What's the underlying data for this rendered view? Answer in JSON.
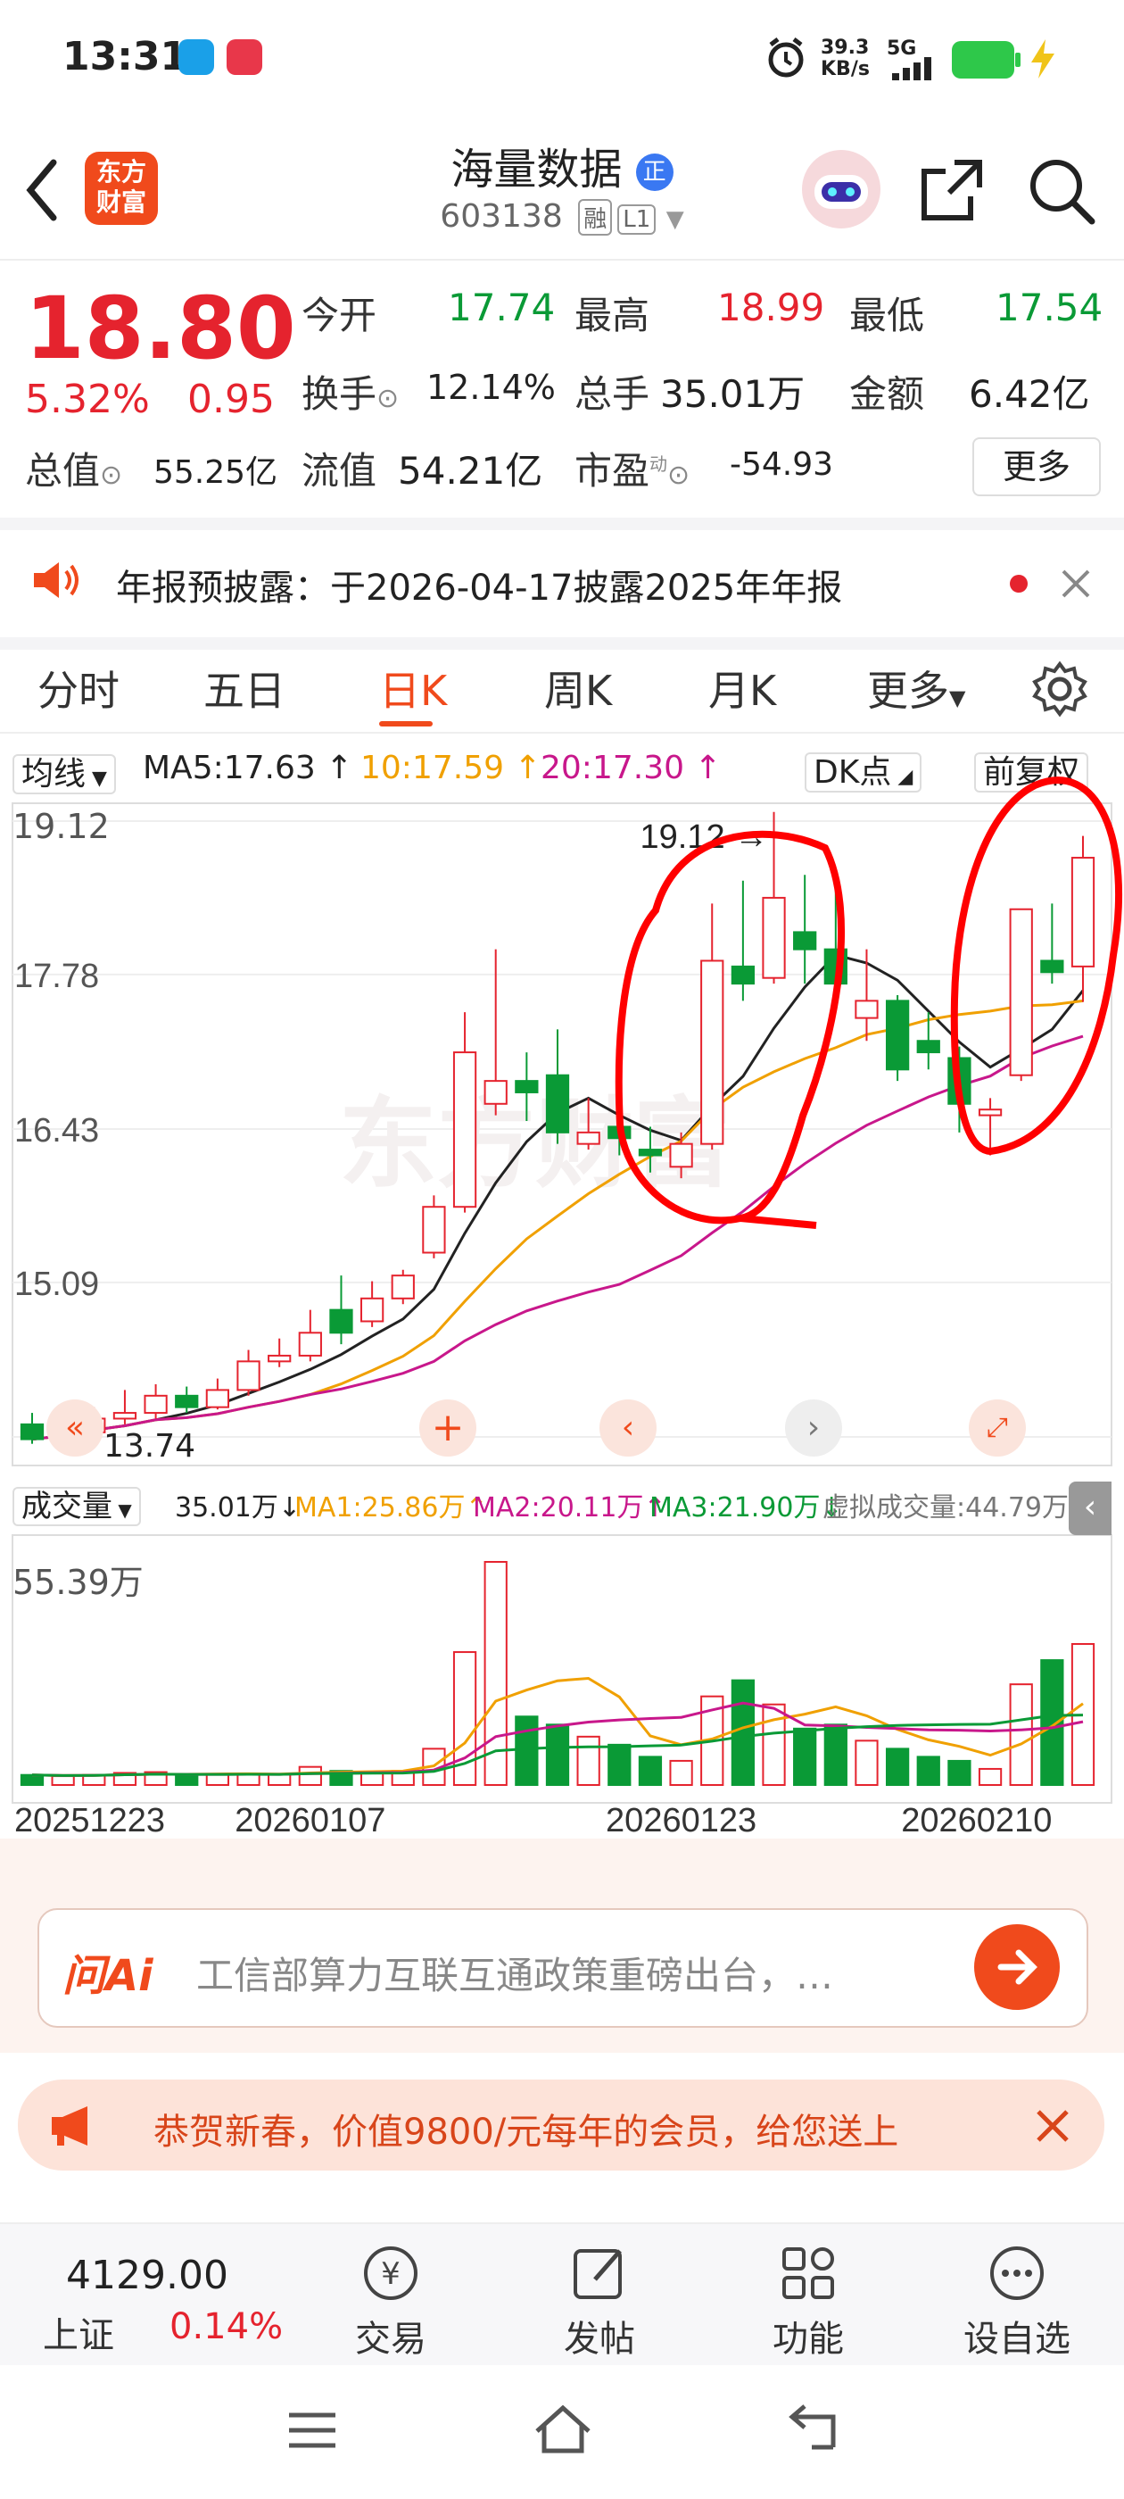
{
  "status_bar": {
    "time": "13:31",
    "speed": "39.3",
    "speed_unit": "KB/s",
    "network": "5G"
  },
  "header": {
    "logo_line1": "东方",
    "logo_line2": "财富",
    "stock_name": "海量数据",
    "badge": "正",
    "stock_code": "603138",
    "tag1": "融",
    "tag2": "L1"
  },
  "quote": {
    "price": "18.80",
    "change_pct": "5.32%",
    "change": "0.95",
    "open_label": "今开",
    "open": "17.74",
    "high_label": "最高",
    "high": "18.99",
    "low_label": "最低",
    "low": "17.54",
    "turnover_label": "换手",
    "turnover": "12.14%",
    "volume_label": "总手",
    "volume": "35.01万",
    "amount_label": "金额",
    "amount": "6.42亿",
    "mktcap_label": "总值",
    "mktcap": "55.25亿",
    "float_label": "流值",
    "float": "54.21亿",
    "pe_label": "市盈",
    "pe_sup": "动",
    "pe": "-54.93",
    "more": "更多"
  },
  "notice": {
    "text": "年报预披露：于2026-04-17披露2025年年报"
  },
  "tabs": {
    "items": [
      "分时",
      "五日",
      "日K",
      "周K",
      "月K",
      "更多"
    ],
    "active": "日K"
  },
  "chart_controls": {
    "ma_selector": "均线",
    "ma5": "MA5:17.63 ↑",
    "ma10": "10:17.59 ↑",
    "ma20": "20:17.30 ↑",
    "dk": "DK点",
    "adjust": "前复权",
    "max_label": "19.12",
    "min_label": "13.74",
    "vol_selector": "成交量",
    "vol": "35.01万↓",
    "vol_ma1": "MA1:25.86万↑",
    "vol_ma2": "MA2:20.11万↑",
    "vol_ma3": "MA3:21.90万↓",
    "virtual_vol": "虚拟成交量:44.79万",
    "vol_max": "55.39万"
  },
  "chart_data": {
    "type": "candlestick",
    "price_axis": {
      "ticks": [
        19.12,
        17.78,
        16.43,
        15.09,
        13.74
      ],
      "range": [
        13.74,
        19.12
      ]
    },
    "dates": [
      "20251223",
      "20260107",
      "20260123",
      "20260210"
    ],
    "candles": [
      {
        "o": 13.85,
        "c": 13.72,
        "h": 13.95,
        "l": 13.68,
        "v": 2.5
      },
      {
        "o": 13.72,
        "c": 13.78,
        "h": 13.85,
        "l": 13.7,
        "v": 2.2
      },
      {
        "o": 13.78,
        "c": 13.9,
        "h": 14.0,
        "l": 13.75,
        "v": 2.5
      },
      {
        "o": 13.9,
        "c": 13.95,
        "h": 14.15,
        "l": 13.85,
        "v": 3.0
      },
      {
        "o": 13.95,
        "c": 14.1,
        "h": 14.2,
        "l": 13.9,
        "v": 3.2
      },
      {
        "o": 14.1,
        "c": 14.0,
        "h": 14.18,
        "l": 13.95,
        "v": 2.4
      },
      {
        "o": 14.0,
        "c": 14.15,
        "h": 14.25,
        "l": 13.98,
        "v": 2.6
      },
      {
        "o": 14.15,
        "c": 14.4,
        "h": 14.5,
        "l": 14.1,
        "v": 2.8
      },
      {
        "o": 14.4,
        "c": 14.45,
        "h": 14.6,
        "l": 14.35,
        "v": 2.6
      },
      {
        "o": 14.45,
        "c": 14.65,
        "h": 14.85,
        "l": 14.4,
        "v": 4.5
      },
      {
        "o": 14.85,
        "c": 14.65,
        "h": 15.15,
        "l": 14.55,
        "v": 3.5
      },
      {
        "o": 14.75,
        "c": 14.95,
        "h": 15.1,
        "l": 14.7,
        "v": 3.2
      },
      {
        "o": 14.95,
        "c": 15.15,
        "h": 15.2,
        "l": 14.9,
        "v": 3.5
      },
      {
        "o": 15.35,
        "c": 15.75,
        "h": 15.85,
        "l": 15.3,
        "v": 9.0
      },
      {
        "o": 15.75,
        "c": 17.1,
        "h": 17.45,
        "l": 15.7,
        "v": 33.0
      },
      {
        "o": 16.65,
        "c": 16.85,
        "h": 18.0,
        "l": 16.55,
        "v": 55.39
      },
      {
        "o": 16.85,
        "c": 16.75,
        "h": 17.1,
        "l": 16.5,
        "v": 17.0
      },
      {
        "o": 16.9,
        "c": 16.4,
        "h": 17.3,
        "l": 16.3,
        "v": 15.0
      },
      {
        "o": 16.3,
        "c": 16.4,
        "h": 16.7,
        "l": 16.25,
        "v": 12.0
      },
      {
        "o": 16.45,
        "c": 16.35,
        "h": 16.5,
        "l": 16.2,
        "v": 10.0
      },
      {
        "o": 16.25,
        "c": 16.2,
        "h": 16.45,
        "l": 16.05,
        "v": 7.0
      },
      {
        "o": 16.1,
        "c": 16.3,
        "h": 16.4,
        "l": 16.0,
        "v": 6.0
      },
      {
        "o": 16.3,
        "c": 17.9,
        "h": 18.4,
        "l": 16.25,
        "v": 22.0
      },
      {
        "o": 17.85,
        "c": 17.7,
        "h": 18.6,
        "l": 17.55,
        "v": 26.0
      },
      {
        "o": 17.75,
        "c": 18.45,
        "h": 19.2,
        "l": 17.7,
        "v": 20.0
      },
      {
        "o": 18.15,
        "c": 18.0,
        "h": 18.65,
        "l": 17.7,
        "v": 14.0
      },
      {
        "o": 18.0,
        "c": 17.7,
        "h": 18.7,
        "l": 17.6,
        "v": 15.0
      },
      {
        "o": 17.4,
        "c": 17.55,
        "h": 18.0,
        "l": 17.2,
        "v": 11.0
      },
      {
        "o": 17.55,
        "c": 16.95,
        "h": 17.6,
        "l": 16.85,
        "v": 9.0
      },
      {
        "o": 17.2,
        "c": 17.1,
        "h": 17.45,
        "l": 16.95,
        "v": 7.0
      },
      {
        "o": 17.05,
        "c": 16.65,
        "h": 17.15,
        "l": 16.4,
        "v": 6.0
      },
      {
        "o": 16.55,
        "c": 16.6,
        "h": 16.7,
        "l": 16.2,
        "v": 4.0
      },
      {
        "o": 16.9,
        "c": 18.35,
        "h": 18.35,
        "l": 16.85,
        "v": 25.0
      },
      {
        "o": 17.9,
        "c": 17.8,
        "h": 18.4,
        "l": 17.7,
        "v": 31.0
      },
      {
        "o": 17.85,
        "c": 18.8,
        "h": 18.99,
        "l": 17.54,
        "v": 35.01
      }
    ]
  },
  "ai": {
    "logo": "问Ai",
    "query": "工信部算力互联互通政策重磅出台，…"
  },
  "promo": {
    "text": "恭贺新春，价值9800/元每年的会员，给您送上"
  },
  "bottom_nav": {
    "index_value": "4129.00",
    "index_name": "上证",
    "index_change": "0.14%",
    "items": [
      "交易",
      "发帖",
      "功能",
      "设自选"
    ]
  }
}
